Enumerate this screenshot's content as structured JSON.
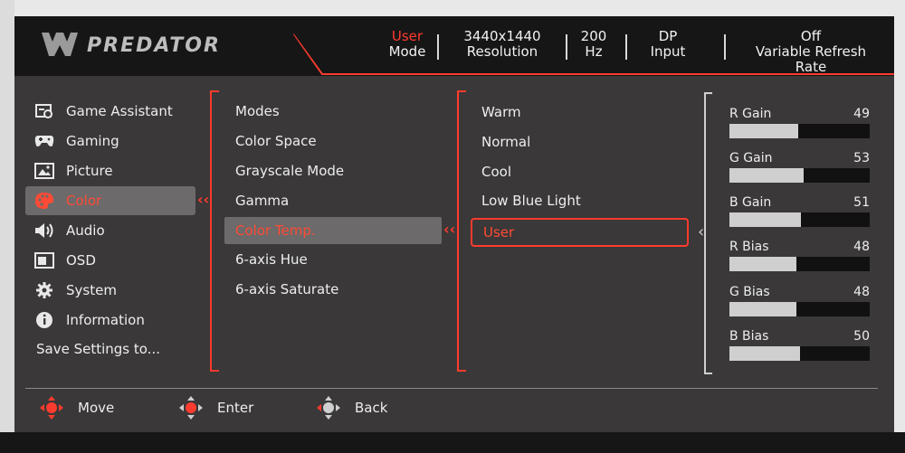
{
  "brand": {
    "logo_text": "PREDATOR"
  },
  "status_bar": [
    {
      "value": "User",
      "label": "Mode",
      "accent": true
    },
    {
      "value": "3440x1440",
      "label": "Resolution",
      "accent": false
    },
    {
      "value": "200",
      "label": "Hz",
      "accent": false
    },
    {
      "value": "DP",
      "label": "Input",
      "accent": false
    },
    {
      "value": "Off",
      "label": "Variable Refresh Rate",
      "accent": false
    }
  ],
  "sidebar": {
    "items": [
      {
        "label": "Game Assistant",
        "icon": "game-assistant-icon"
      },
      {
        "label": "Gaming",
        "icon": "gamepad-icon"
      },
      {
        "label": "Picture",
        "icon": "picture-icon"
      },
      {
        "label": "Color",
        "icon": "palette-icon",
        "active": true
      },
      {
        "label": "Audio",
        "icon": "speaker-icon"
      },
      {
        "label": "OSD",
        "icon": "osd-icon"
      },
      {
        "label": "System",
        "icon": "gear-icon"
      },
      {
        "label": "Information",
        "icon": "info-icon"
      },
      {
        "label": "Save Settings to...",
        "icon": ""
      }
    ]
  },
  "submenu": {
    "items": [
      {
        "label": "Modes"
      },
      {
        "label": "Color Space"
      },
      {
        "label": "Grayscale Mode"
      },
      {
        "label": "Gamma"
      },
      {
        "label": "Color Temp.",
        "active": true
      },
      {
        "label": "6-axis Hue"
      },
      {
        "label": "6-axis Saturate"
      }
    ]
  },
  "options": {
    "items": [
      {
        "label": "Warm"
      },
      {
        "label": "Normal"
      },
      {
        "label": "Cool"
      },
      {
        "label": "Low Blue Light"
      },
      {
        "label": "User",
        "active": true
      }
    ]
  },
  "user_settings": [
    {
      "label": "R Gain",
      "value": "49",
      "level": 49
    },
    {
      "label": "G Gain",
      "value": "53",
      "level": 53
    },
    {
      "label": "B Gain",
      "value": "51",
      "level": 51
    },
    {
      "label": "R Bias",
      "value": "48",
      "level": 48
    },
    {
      "label": "G Bias",
      "value": "48",
      "level": 48
    },
    {
      "label": "B Bias",
      "value": "50",
      "level": 50
    }
  ],
  "footer": [
    {
      "label": "Move",
      "icon": "move-dpad-icon"
    },
    {
      "label": "Enter",
      "icon": "enter-dpad-icon"
    },
    {
      "label": "Back",
      "icon": "back-dpad-icon"
    }
  ],
  "colors": {
    "accent": "#ff3b2f",
    "background": "#3a3838",
    "header": "#161616",
    "highlight": "#6c6a6a"
  }
}
